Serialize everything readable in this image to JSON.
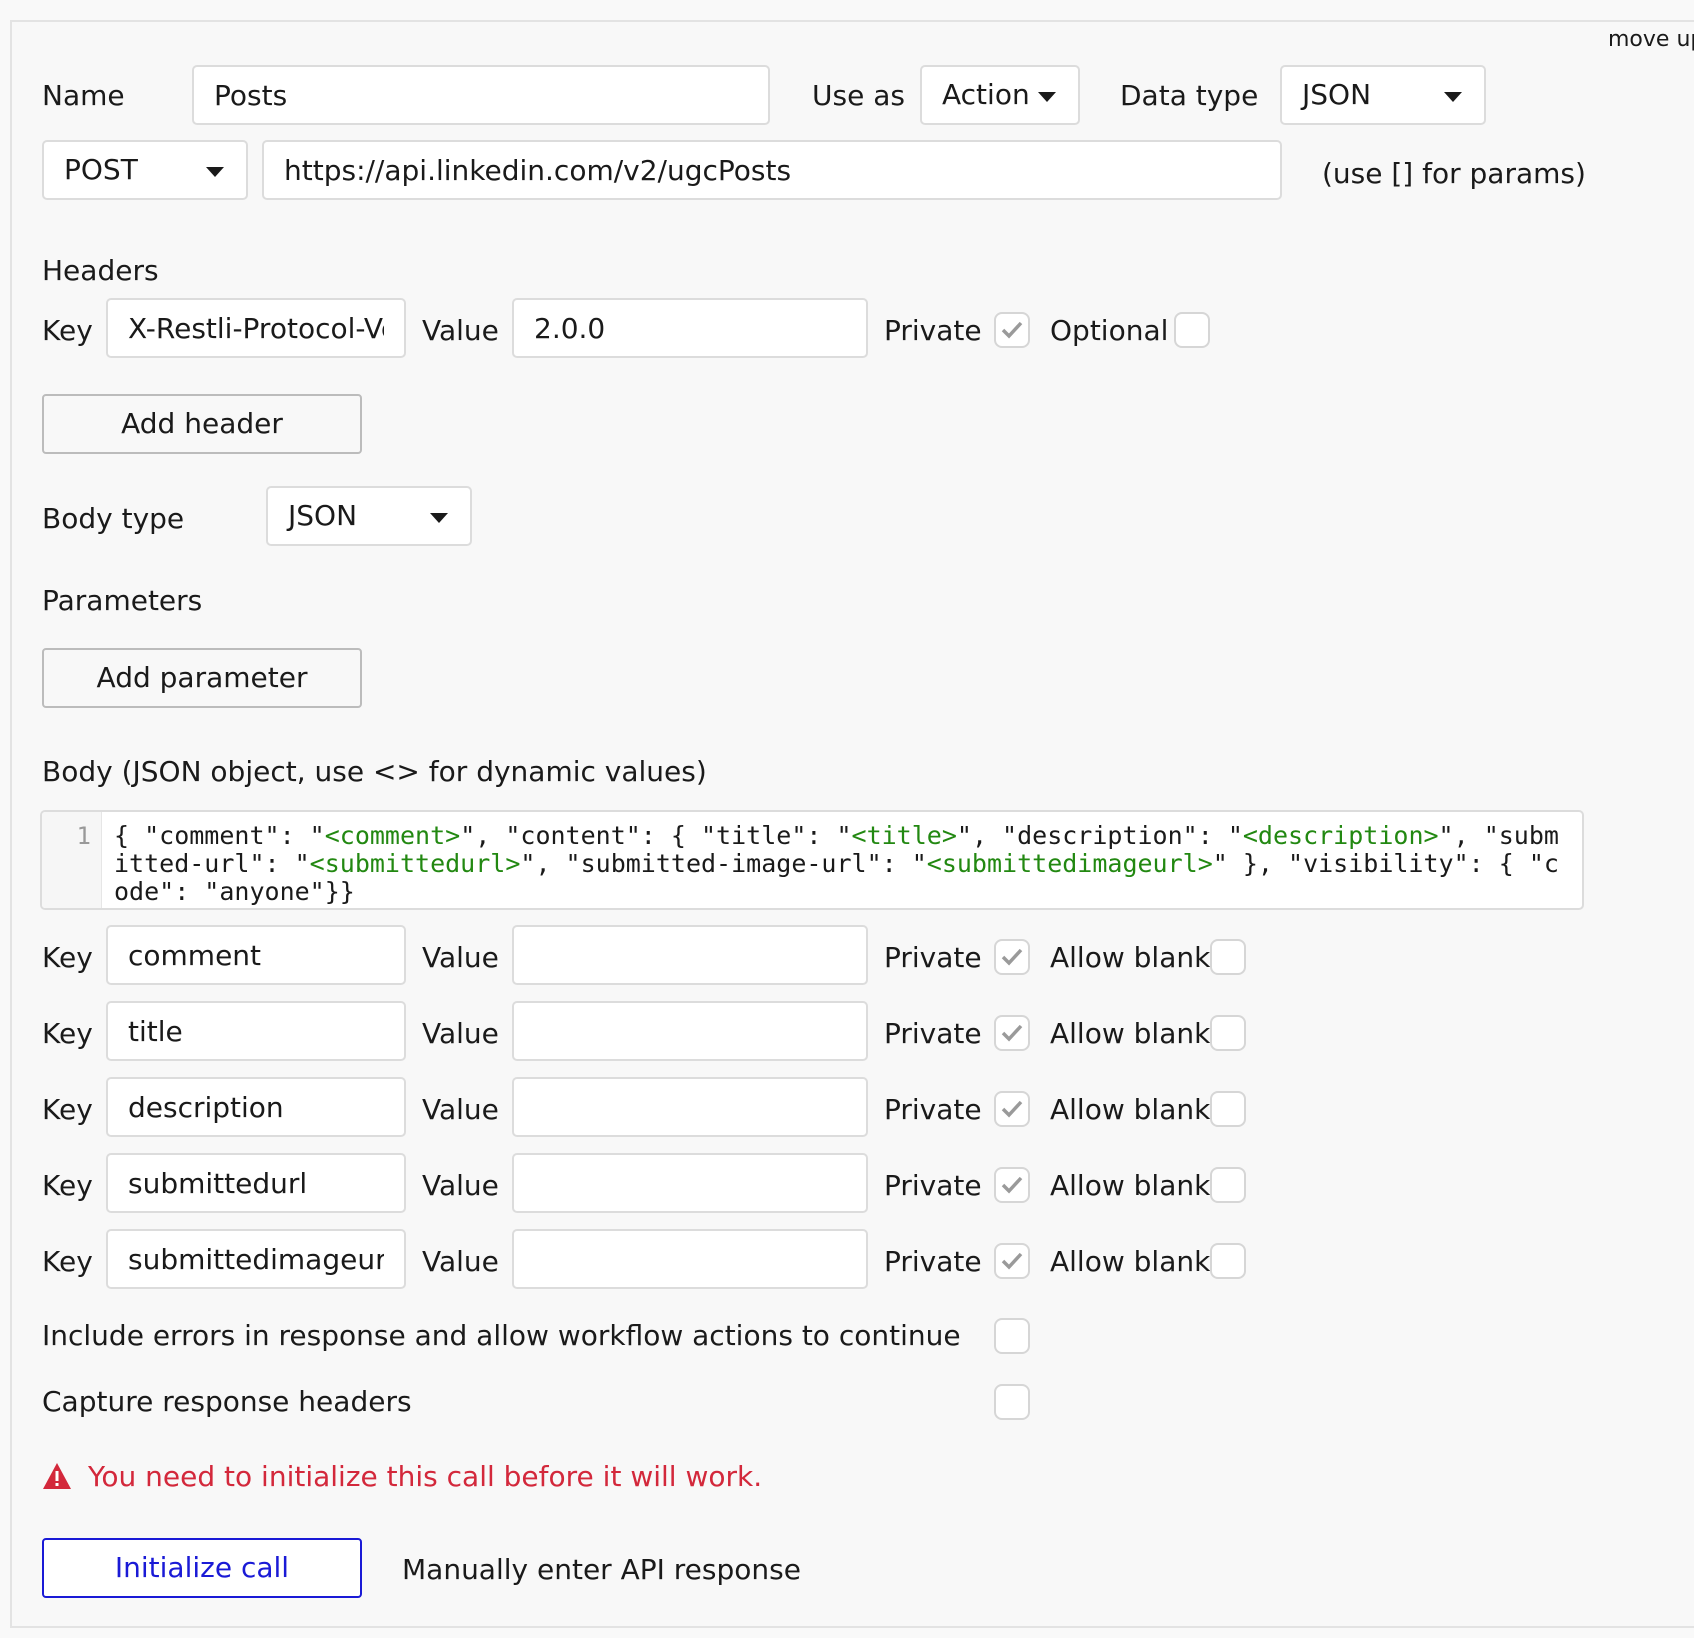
{
  "top": {
    "move_up": "move up"
  },
  "call": {
    "name_label": "Name",
    "name_value": "Posts",
    "use_as_label": "Use as",
    "use_as_value": "Action",
    "data_type_label": "Data type",
    "data_type_value": "JSON",
    "method": "POST",
    "url": "https://api.linkedin.com/v2/ugcPosts",
    "params_hint": "(use [] for params)"
  },
  "headers": {
    "section_label": "Headers",
    "key_label": "Key",
    "value_label": "Value",
    "key": "X-Restli-Protocol-Version",
    "value": "2.0.0",
    "private_label": "Private",
    "private_checked": true,
    "optional_label": "Optional",
    "optional_checked": false,
    "add_button": "Add header"
  },
  "body_type": {
    "label": "Body type",
    "value": "JSON"
  },
  "parameters": {
    "label": "Parameters",
    "add_button": "Add parameter"
  },
  "body": {
    "label": "Body (JSON object, use <> for dynamic values)",
    "line_number": "1",
    "segments": [
      {
        "text": "{ \"comment\": \"",
        "dynamic": false
      },
      {
        "text": "<comment>",
        "dynamic": true
      },
      {
        "text": "\", \"content\": { \"title\": \"",
        "dynamic": false
      },
      {
        "text": "<title>",
        "dynamic": true
      },
      {
        "text": "\", \"description\": \"",
        "dynamic": false
      },
      {
        "text": "<description>",
        "dynamic": true
      },
      {
        "text": "\", \"submitted-url\": \"",
        "dynamic": false
      },
      {
        "text": "<submittedurl>",
        "dynamic": true
      },
      {
        "text": "\", \"submitted-image-url\": \"",
        "dynamic": false
      },
      {
        "text": "<submittedimageurl>",
        "dynamic": true
      },
      {
        "text": "\" }, \"visibility\": { \"code\": \"anyone\"}}",
        "dynamic": false
      }
    ]
  },
  "body_params": {
    "key_label": "Key",
    "value_label": "Value",
    "private_label": "Private",
    "allow_blank_label": "Allow blank",
    "rows": [
      {
        "key": "comment",
        "value": "",
        "private": true,
        "allow_blank": false
      },
      {
        "key": "title",
        "value": "",
        "private": true,
        "allow_blank": false
      },
      {
        "key": "description",
        "value": "",
        "private": true,
        "allow_blank": false
      },
      {
        "key": "submittedurl",
        "value": "",
        "private": true,
        "allow_blank": false
      },
      {
        "key": "submittedimageurl",
        "value": "",
        "private": true,
        "allow_blank": false
      }
    ]
  },
  "options": {
    "include_errors_label": "Include errors in response and allow workflow actions to continue",
    "include_errors_checked": false,
    "capture_headers_label": "Capture response headers",
    "capture_headers_checked": false
  },
  "warning": {
    "icon": "warning-triangle-icon",
    "text": "You need to initialize this call before it will work.",
    "color": "#d3283b"
  },
  "footer": {
    "initialize_button": "Initialize call",
    "manual_link": "Manually enter API response"
  }
}
